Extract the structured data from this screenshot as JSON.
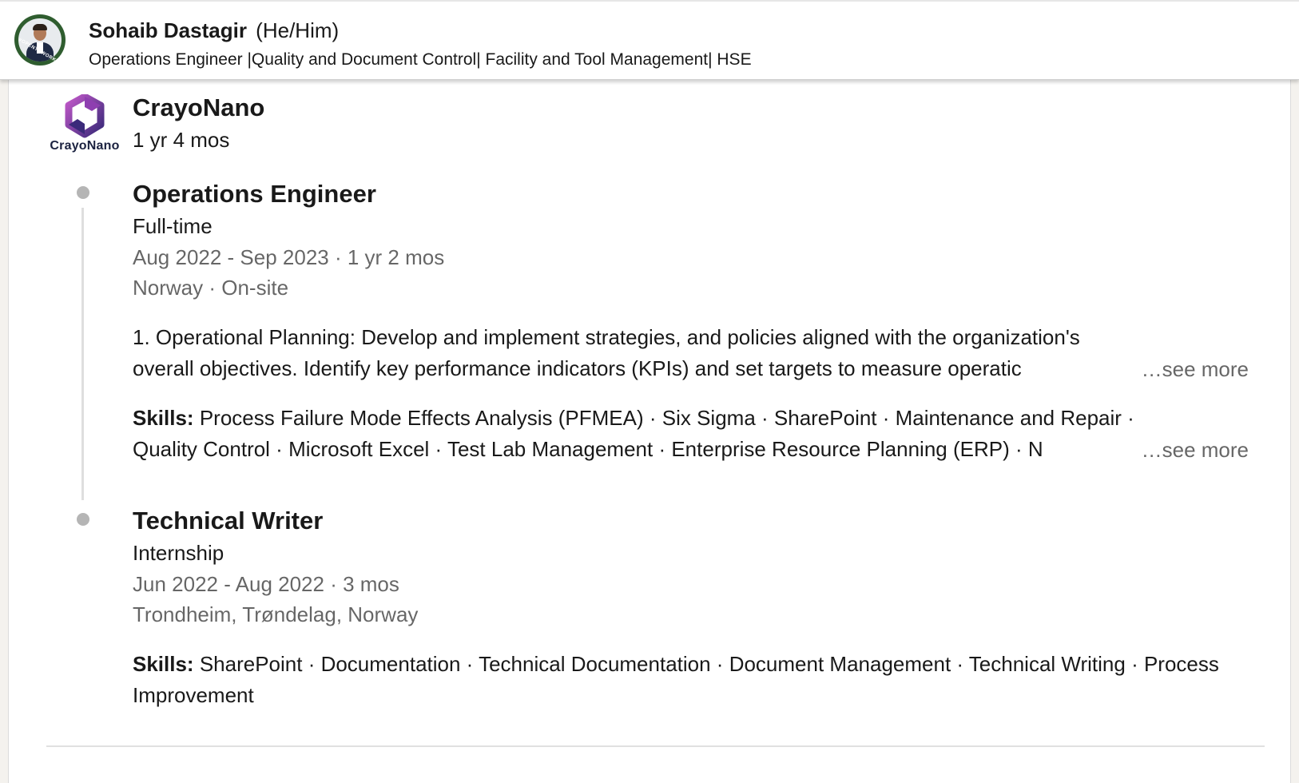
{
  "header": {
    "name": "Sohaib Dastagir",
    "pronouns": "(He/Him)",
    "headline": "Operations Engineer |Quality and Document Control| Facility and Tool Management| HSE",
    "avatar_badge": "#OPENTOWORK"
  },
  "company": {
    "logo_text": "CrayoNano",
    "name": "CrayoNano",
    "duration": "1 yr 4 mos",
    "logo_colors": [
      "#3b2a7a",
      "#8e3fb0",
      "#c058c8"
    ]
  },
  "roles": [
    {
      "title": "Operations Engineer",
      "employment_type": "Full-time",
      "dates": "Aug 2022 - Sep 2023 · 1 yr 2 mos",
      "location": "Norway · On-site",
      "description_line1": "1. Operational Planning: Develop and implement strategies, and policies aligned with the organization's",
      "description_line2": "overall objectives. Identify key performance indicators (KPIs) and set targets to measure operatic",
      "description_see_more": "…see more",
      "skills_label": "Skills:",
      "skills_line1": "Process Failure Mode Effects Analysis (PFMEA) · Six Sigma · SharePoint · Maintenance and Repair ·",
      "skills_line2": "Quality Control · Microsoft Excel · Test Lab Management · Enterprise Resource Planning (ERP) · N",
      "skills_see_more": "…see more"
    },
    {
      "title": "Technical Writer",
      "employment_type": "Internship",
      "dates": "Jun 2022 - Aug 2022 · 3 mos",
      "location": "Trondheim, Trøndelag, Norway",
      "skills_label": "Skills:",
      "skills_text": "SharePoint · Documentation · Technical Documentation · Document Management · Technical Writing · Process Improvement"
    }
  ]
}
